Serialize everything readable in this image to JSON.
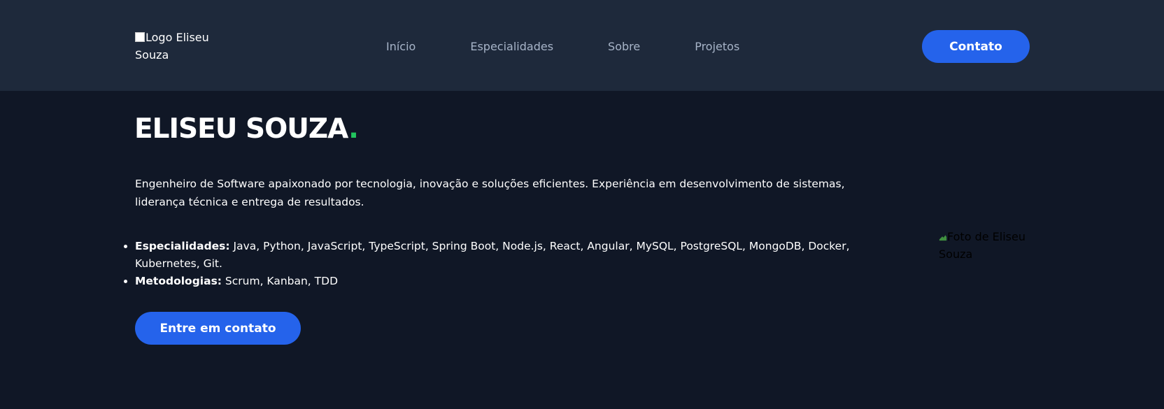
{
  "header": {
    "logo_alt": "Logo Eliseu Souza",
    "nav": [
      {
        "label": "Início"
      },
      {
        "label": "Especialidades"
      },
      {
        "label": "Sobre"
      },
      {
        "label": "Projetos"
      }
    ],
    "contact_label": "Contato"
  },
  "hero": {
    "title": "ELISEU SOUZA",
    "title_dot": ".",
    "description": "Engenheiro de Software apaixonado por tecnologia, inovação e soluções eficientes. Experiência em desenvolvimento de sistemas, liderança técnica e entrega de resultados.",
    "skills": [
      {
        "label": "Especialidades:",
        "value": " Java, Python, JavaScript, TypeScript, Spring Boot, Node.js, React, Angular, MySQL, PostgreSQL, MongoDB, Docker, Kubernetes, Git."
      },
      {
        "label": "Metodologias:",
        "value": " Scrum, Kanban, TDD"
      }
    ],
    "cta_label": "Entre em contato",
    "photo_alt": "Foto de Eliseu Souza"
  },
  "colors": {
    "header_bg": "#1e293b",
    "page_bg": "#101726",
    "accent": "#2563eb",
    "dot": "#22c55e",
    "nav_text": "#a7b4c8"
  },
  "icons": {
    "logo": "broken-image-icon",
    "photo": "broken-image-icon",
    "bullet": "bullet-dot"
  }
}
